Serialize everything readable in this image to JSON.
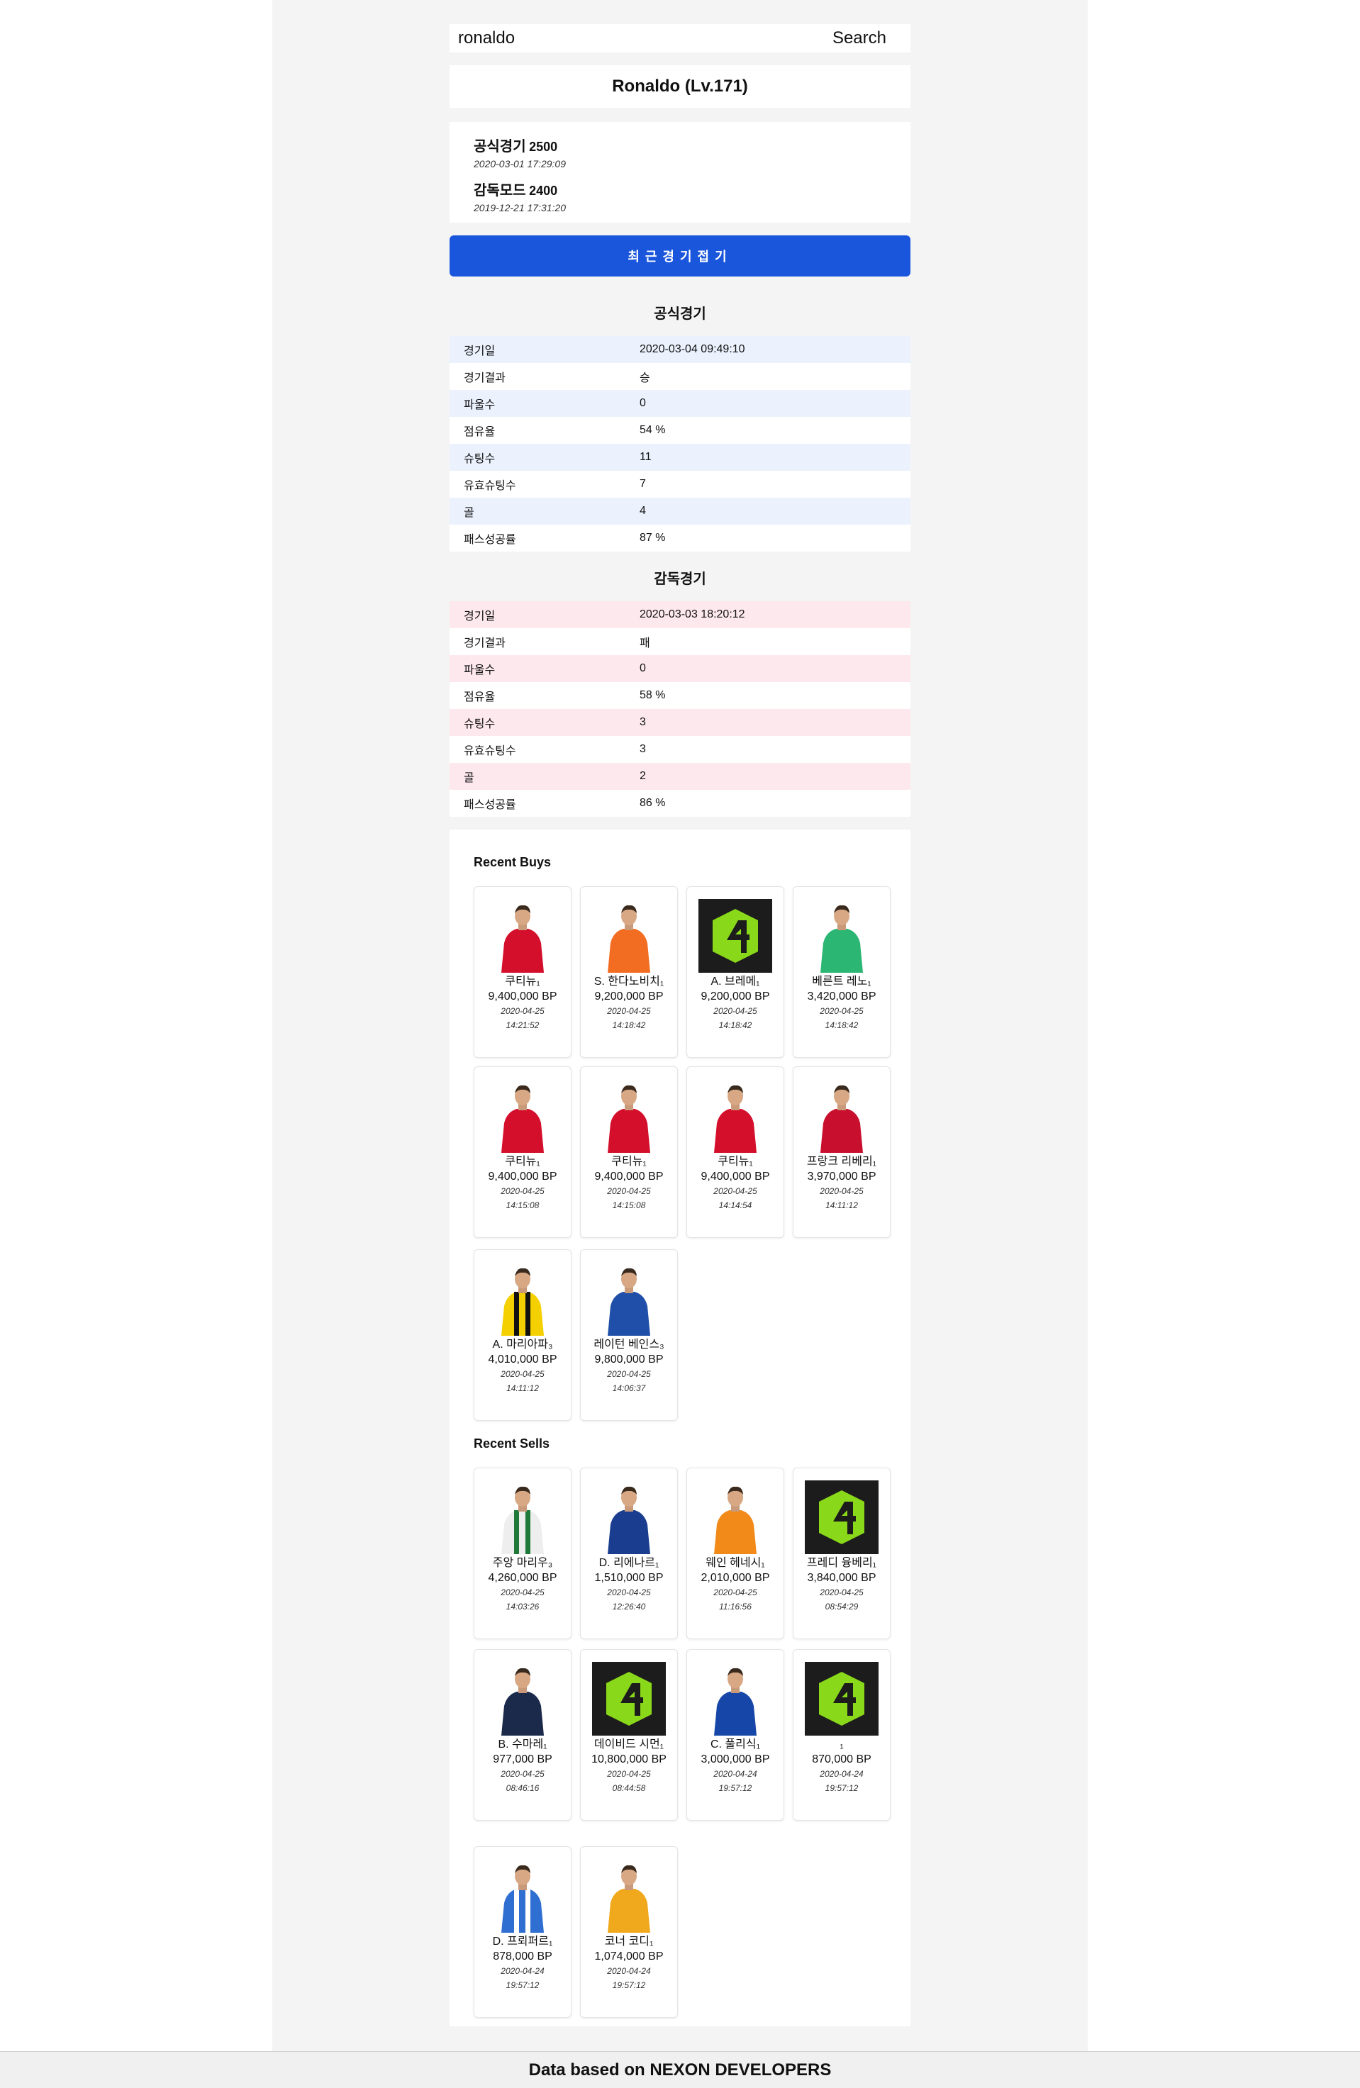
{
  "search": {
    "value": "ronaldo",
    "button_label": "Search"
  },
  "user": {
    "title": "Ronaldo (Lv.171)"
  },
  "ranks": [
    {
      "name": "공식경기",
      "score": "2500",
      "date": "2020-03-01 17:29:09"
    },
    {
      "name": "감독모드",
      "score": "2400",
      "date": "2019-12-21 17:31:20"
    }
  ],
  "toggle_label": "최근경기접기",
  "official": {
    "title": "공식경기",
    "rows": [
      {
        "k": "경기일",
        "v": "2020-03-04 09:49:10"
      },
      {
        "k": "경기결과",
        "v": "승"
      },
      {
        "k": "파울수",
        "v": "0"
      },
      {
        "k": "점유율",
        "v": "54 %"
      },
      {
        "k": "슈팅수",
        "v": "11"
      },
      {
        "k": "유효슈팅수",
        "v": "7"
      },
      {
        "k": "골",
        "v": "4"
      },
      {
        "k": "패스성공률",
        "v": "87 %"
      }
    ]
  },
  "manager": {
    "title": "감독경기",
    "rows": [
      {
        "k": "경기일",
        "v": "2020-03-03 18:20:12"
      },
      {
        "k": "경기결과",
        "v": "패"
      },
      {
        "k": "파울수",
        "v": "0"
      },
      {
        "k": "점유율",
        "v": "58 %"
      },
      {
        "k": "슈팅수",
        "v": "3"
      },
      {
        "k": "유효슈팅수",
        "v": "3"
      },
      {
        "k": "골",
        "v": "2"
      },
      {
        "k": "패스성공률",
        "v": "86 %"
      }
    ]
  },
  "buys": {
    "title": "Recent Buys",
    "items": [
      {
        "name": "쿠티뉴₁",
        "price": "9,400,000 BP",
        "date": "2020-04-25",
        "time": "14:21:52",
        "img": "red-kit-player",
        "kit": "#d40f2c"
      },
      {
        "name": "S. 한다노비치₁",
        "price": "9,200,000 BP",
        "date": "2020-04-25",
        "time": "14:18:42",
        "img": "keeper-orange-player",
        "kit": "#f26c21"
      },
      {
        "name": "A. 브레메₁",
        "price": "9,200,000 BP",
        "date": "2020-04-25",
        "time": "14:18:42",
        "img": "fifa4-logo",
        "kit": ""
      },
      {
        "name": "베른트 레노₁",
        "price": "3,420,000 BP",
        "date": "2020-04-25",
        "time": "14:18:42",
        "img": "keeper-green-player",
        "kit": "#2bb673"
      },
      {
        "name": "쿠티뉴₁",
        "price": "9,400,000 BP",
        "date": "2020-04-25",
        "time": "14:15:08",
        "img": "red-kit-player",
        "kit": "#d40f2c"
      },
      {
        "name": "쿠티뉴₁",
        "price": "9,400,000 BP",
        "date": "2020-04-25",
        "time": "14:15:08",
        "img": "red-kit-player",
        "kit": "#d40f2c"
      },
      {
        "name": "쿠티뉴₁",
        "price": "9,400,000 BP",
        "date": "2020-04-25",
        "time": "14:14:54",
        "img": "red-kit-player",
        "kit": "#d40f2c"
      },
      {
        "name": "프랑크 리베리₁",
        "price": "3,970,000 BP",
        "date": "2020-04-25",
        "time": "14:11:12",
        "img": "red-kit-player",
        "kit": "#c8102e"
      },
      {
        "name": "A. 마리아파₃",
        "price": "4,010,000 BP",
        "date": "2020-04-25",
        "time": "14:11:12",
        "img": "yellow-stripe-player",
        "kit": "#f5d000"
      },
      {
        "name": "레이턴 베인스₃",
        "price": "9,800,000 BP",
        "date": "2020-04-25",
        "time": "14:06:37",
        "img": "blue-kit-player",
        "kit": "#1f4fa8"
      }
    ]
  },
  "sells": {
    "title": "Recent Sells",
    "items": [
      {
        "name": "주앙 마리우₃",
        "price": "4,260,000 BP",
        "date": "2020-04-25",
        "time": "14:03:26",
        "img": "white-green-player",
        "kit": "#eeeeee"
      },
      {
        "name": "D. 리에나르₁",
        "price": "1,510,000 BP",
        "date": "2020-04-25",
        "time": "12:26:40",
        "img": "blue-kit-player",
        "kit": "#1a3d8f"
      },
      {
        "name": "웨인 헤네시₁",
        "price": "2,010,000 BP",
        "date": "2020-04-25",
        "time": "11:16:56",
        "img": "keeper-orange-player",
        "kit": "#f28a1a"
      },
      {
        "name": "프레디 융베리₁",
        "price": "3,840,000 BP",
        "date": "2020-04-25",
        "time": "08:54:29",
        "img": "fifa4-logo",
        "kit": ""
      },
      {
        "name": "B. 수마레₁",
        "price": "977,000 BP",
        "date": "2020-04-25",
        "time": "08:46:16",
        "img": "navy-kit-player",
        "kit": "#1b2a4a"
      },
      {
        "name": "데이비드 시먼₁",
        "price": "10,800,000 BP",
        "date": "2020-04-25",
        "time": "08:44:58",
        "img": "fifa4-logo",
        "kit": ""
      },
      {
        "name": "C. 풀리식₁",
        "price": "3,000,000 BP",
        "date": "2020-04-24",
        "time": "19:57:12",
        "img": "blue-kit-player",
        "kit": "#1646a8"
      },
      {
        "name": "₁",
        "price": "870,000 BP",
        "date": "2020-04-24",
        "time": "19:57:12",
        "img": "fifa4-logo",
        "kit": ""
      },
      {
        "name": "D. 프뢰퍼르₁",
        "price": "878,000 BP",
        "date": "2020-04-24",
        "time": "19:57:12",
        "img": "blue-stripe-player",
        "kit": "#2e6fd1"
      },
      {
        "name": "코너 코디₁",
        "price": "1,074,000 BP",
        "date": "2020-04-24",
        "time": "19:57:12",
        "img": "gold-kit-player",
        "kit": "#f0a81c"
      }
    ]
  },
  "footer": "Data based on NEXON DEVELOPERS"
}
